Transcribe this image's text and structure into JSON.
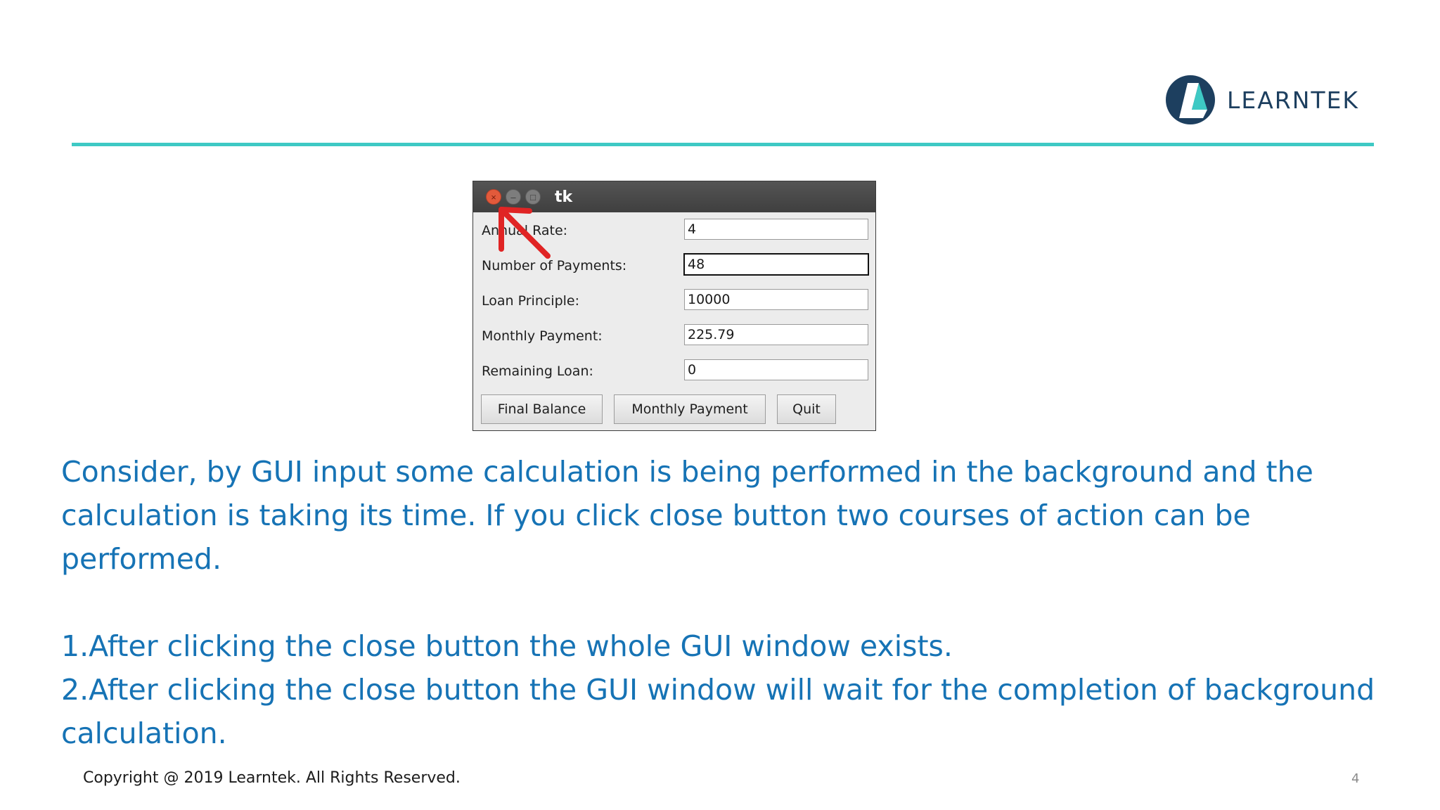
{
  "brand": {
    "name": "LEARNTEK",
    "rule_color": "#3ec9c4",
    "logo_dark": "#1d3f5f",
    "logo_accent": "#3ec9c4"
  },
  "window": {
    "title": "tk",
    "controls": [
      "close-icon",
      "minimize-icon",
      "maximize-icon"
    ],
    "fields": [
      {
        "label": "Annual Rate:",
        "value": "4"
      },
      {
        "label": "Number of Payments:",
        "value": "48"
      },
      {
        "label": "Loan Principle:",
        "value": "10000"
      },
      {
        "label": "Monthly Payment:",
        "value": "225.79"
      },
      {
        "label": "Remaining Loan:",
        "value": "0"
      }
    ],
    "buttons": {
      "final_balance": "Final Balance",
      "monthly_payment": "Monthly Payment",
      "quit": "Quit"
    },
    "annotation_color": "#e02424"
  },
  "slide": {
    "paragraph": "Consider, by GUI input some calculation is being performed in the background and the calculation is taking its time. If you click close button two courses of action can be performed.",
    "point1": "1.After clicking the close button the whole GUI window exists.",
    "point2": "2.After clicking the close button the GUI window will wait for the completion of background calculation.",
    "text_color": "#1673b5"
  },
  "footer": {
    "copyright": "Copyright @ 2019 Learntek. All Rights Reserved.",
    "page_number": "4"
  }
}
